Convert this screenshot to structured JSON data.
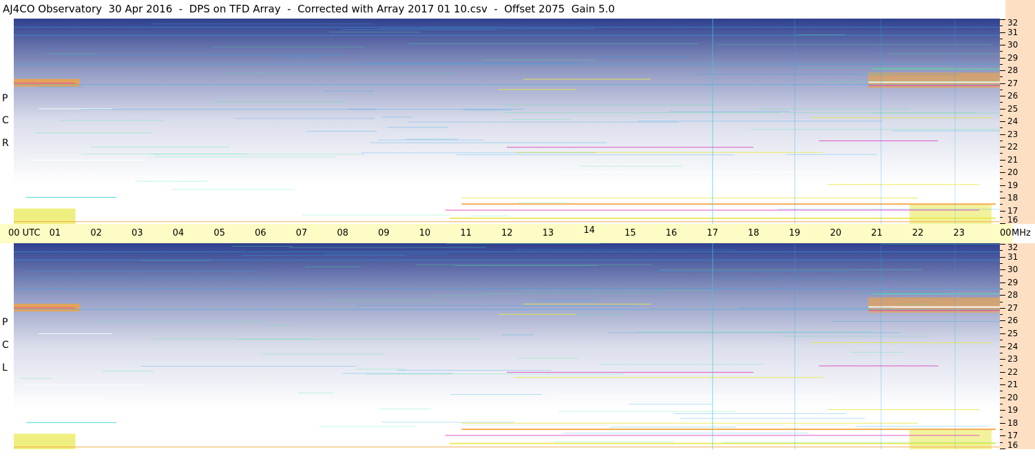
{
  "title": "AJ4CO Observatory  30 Apr 2016  -  DPS on TFD Array  -  Corrected with Array 2017 01 10.csv  -  Offset 2075  Gain 5.0",
  "panels": [
    {
      "id": "rcp",
      "label_letters": [
        "P",
        "C",
        "R"
      ]
    },
    {
      "id": "lcp",
      "label_letters": [
        "P",
        "C",
        "L"
      ]
    }
  ],
  "time_axis": {
    "first_label": "00  UTC",
    "labels": [
      "01",
      "02",
      "03",
      "04",
      "05",
      "06",
      "07",
      "08",
      "09",
      "10",
      "11",
      "12",
      "13",
      "14",
      "15",
      "16",
      "17",
      "18",
      "19",
      "20",
      "21",
      "22",
      "23"
    ],
    "last_label": "00",
    "unit": "MHz"
  },
  "colors": {
    "deep": "#0a1e7a",
    "dark": "#0b3aa8",
    "mid": "#1f6be0",
    "bright": "#2fa7ee",
    "cyan": "#36d3d2",
    "green": "#4fe8a0",
    "yellow": "#e8e84a",
    "orange": "#f4a23c",
    "rfi_white": "#ffffff",
    "rfi_magenta": "#e040c0",
    "axis_freq_bg": "#fde0c4",
    "axis_time_bg": "#fdfcc4"
  },
  "chart_data": {
    "type": "heatmap",
    "title": "AJ4CO Observatory  30 Apr 2016  -  DPS on TFD Array  -  Corrected with Array 2017 01 10.csv  -  Offset 2075  Gain 5.0",
    "xlabel": "UTC",
    "ylabel": "MHz",
    "x_range_hours": [
      0,
      24
    ],
    "y_range_mhz": [
      16,
      32
    ],
    "y_ticks": [
      16,
      17,
      18,
      19,
      20,
      21,
      22,
      23,
      24,
      25,
      26,
      27,
      28,
      29,
      30,
      31,
      32
    ],
    "x_ticks": [
      "00",
      "01",
      "02",
      "03",
      "04",
      "05",
      "06",
      "07",
      "08",
      "09",
      "10",
      "11",
      "12",
      "13",
      "14",
      "15",
      "16",
      "17",
      "18",
      "19",
      "20",
      "21",
      "22",
      "23",
      "00"
    ],
    "panels": [
      "RCP",
      "LCP"
    ]
  }
}
